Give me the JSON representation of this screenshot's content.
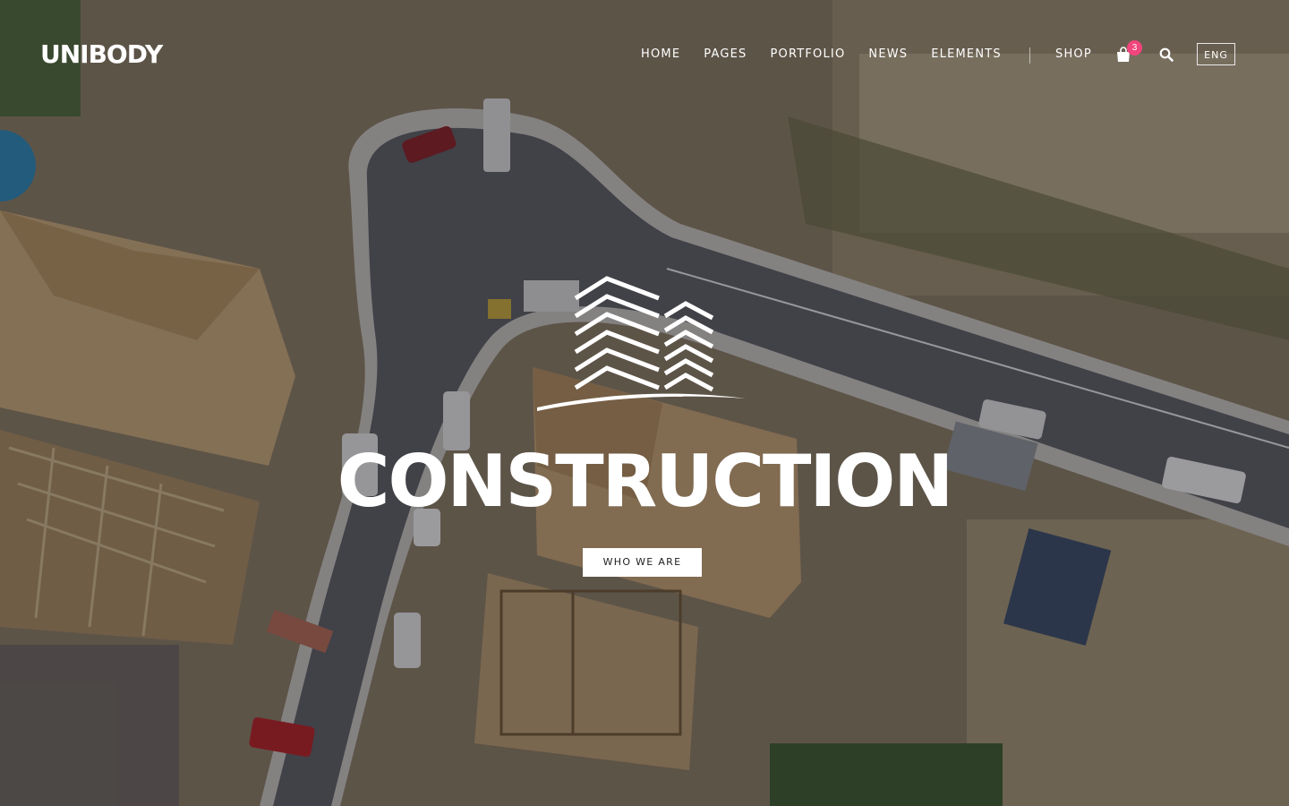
{
  "brand": {
    "name": "UNIBODY"
  },
  "nav": {
    "items": [
      {
        "label": "HOME"
      },
      {
        "label": "PAGES"
      },
      {
        "label": "PORTFOLIO"
      },
      {
        "label": "NEWS"
      },
      {
        "label": "ELEMENTS"
      }
    ],
    "shop_label": "SHOP",
    "cart_count": "3",
    "language": "ENG"
  },
  "hero": {
    "title": "CONSTRUCTION",
    "cta_label": "WHO WE ARE"
  },
  "colors": {
    "badge": "#f1457d",
    "overlay": "#14161e"
  },
  "icons": {
    "cart": "shopping-bag-icon",
    "search": "search-icon",
    "hero_logo": "buildings-logo-icon"
  }
}
